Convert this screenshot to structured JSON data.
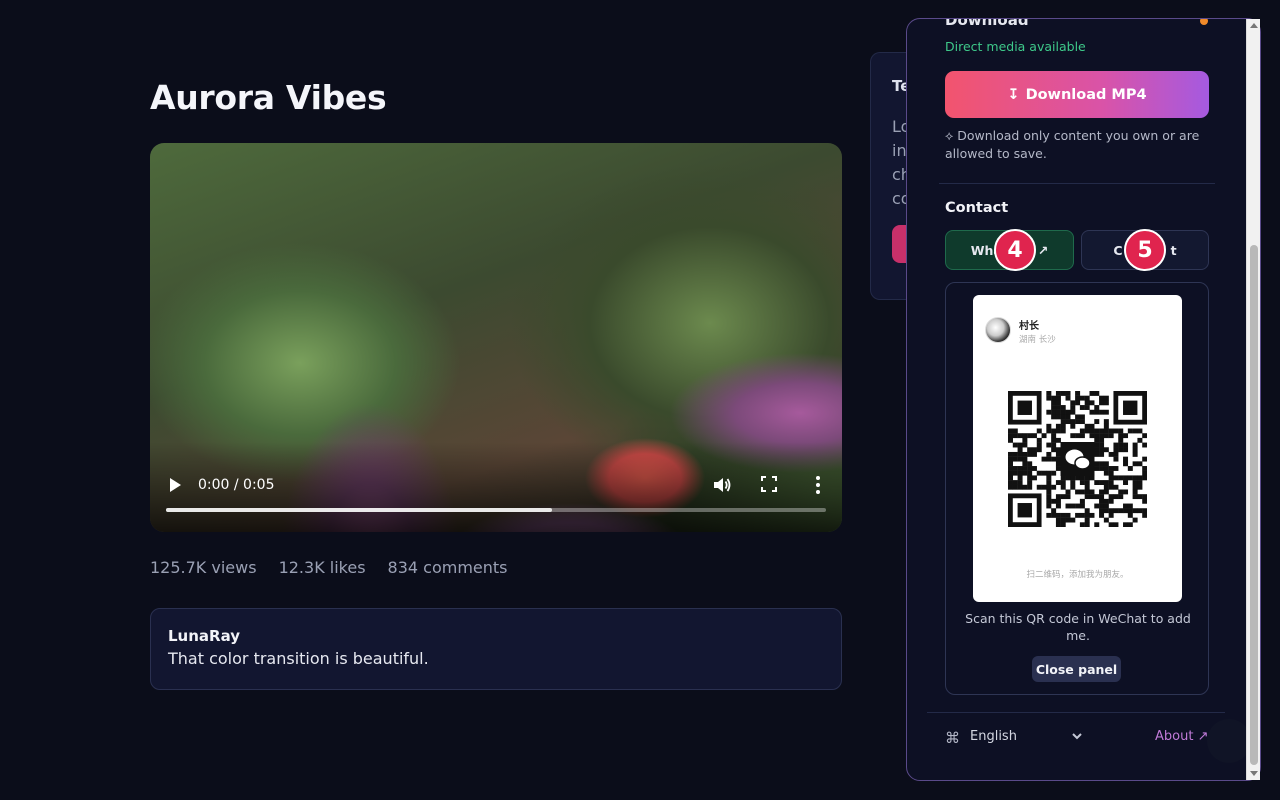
{
  "page": {
    "title": "Aurora Vibes"
  },
  "video": {
    "time": "0:00 / 0:05",
    "progress_fraction": 0.585
  },
  "stats": {
    "views": "125.7K views",
    "likes": "12.3K likes",
    "comments": "834 comments"
  },
  "comment": {
    "author": "LunaRay",
    "text": "That color transition is beautiful."
  },
  "behind_card": {
    "title": "Test p",
    "lines": [
      "Load",
      "insta",
      "check",
      "comp"
    ]
  },
  "panel": {
    "download_heading": "Download",
    "direct_status": "Direct media available",
    "download_button": "Download MP4",
    "download_icon": "↧",
    "note": "⟡ Download only content you own or are allowed to save.",
    "contact_heading": "Contact",
    "whatsapp_label": "Wha",
    "whatsapp_arrow": "↗",
    "wechat_label": "t",
    "wechat_icon": "C",
    "badges": [
      "4",
      "5"
    ],
    "qr": {
      "name": "村长",
      "location": "湖南 长沙",
      "caption": "扫二维码，添加我为朋友。"
    },
    "scan_text": "Scan this QR code in WeChat to add me.",
    "close_button": "Close panel",
    "language": "English",
    "language_icon": "⌘",
    "about": "About ↗"
  },
  "colors": {
    "background": "#0b0d1a",
    "accent_gradient_start": "#f2546e",
    "accent_gradient_end": "#a55ae0",
    "success": "#3ec98a",
    "badge": "#e0244e",
    "link": "#c07ad8"
  }
}
